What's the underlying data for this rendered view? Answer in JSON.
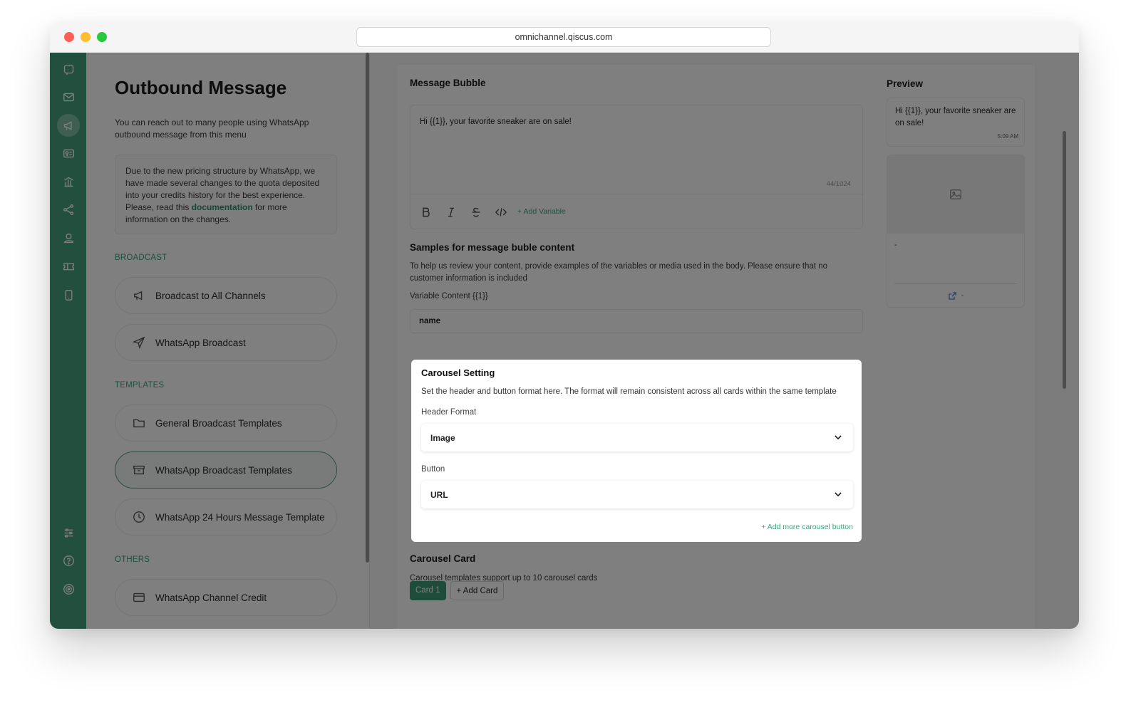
{
  "browser": {
    "url": "omnichannel.qiscus.com"
  },
  "rail": {
    "icons": [
      "chat-icon",
      "mail-icon",
      "megaphone-icon",
      "contact-card-icon",
      "analytics-icon",
      "integration-icon",
      "user-icon",
      "ticket-icon",
      "mobile-icon",
      "settings-sliders-icon",
      "help-icon",
      "target-icon"
    ]
  },
  "sidebar": {
    "title": "Outbound Message",
    "description": "You can reach out to many people using WhatsApp outbound message from this menu",
    "notice_before": "Due to the new pricing structure by WhatsApp, we have made several changes to the quota deposited into your credits history for the best experience. Please, read this ",
    "notice_link": "documentation",
    "notice_after": " for more information on the changes.",
    "sections": {
      "broadcast": "BROADCAST",
      "templates": "TEMPLATES",
      "others": "OTHERS"
    },
    "items": {
      "broadcast_all": "Broadcast to All Channels",
      "whatsapp_broadcast": "WhatsApp Broadcast",
      "general_templates": "General Broadcast Templates",
      "whatsapp_templates": "WhatsApp Broadcast Templates",
      "wa_24h_template": "WhatsApp 24 Hours Message Template",
      "channel_credit": "WhatsApp Channel Credit"
    }
  },
  "editor": {
    "bubble_title": "Message Bubble",
    "message": "Hi {{1}}, your favorite sneaker are on sale!",
    "counter": "44/1024",
    "add_variable": "+ Add Variable",
    "samples_title": "Samples for message buble content",
    "samples_desc": "To help us review your content, provide examples of the variables or media used in the body. Please ensure that no customer information is included",
    "variable_label": "Variable Content {{1}}",
    "variable_value": "name",
    "carousel_card_title": "Carousel Card",
    "carousel_card_desc": "Carousel templates support up to 10 carousel cards",
    "card_tab": "Card 1",
    "add_card": "+ Add Card"
  },
  "preview": {
    "title": "Preview",
    "message": "Hi {{1}}, your favorite sneaker are on sale!",
    "time": "5:09 AM",
    "card_body": "-",
    "card_button": "-"
  },
  "modal": {
    "title": "Carousel Setting",
    "description": "Set the header and button format here. The format will remain consistent across all cards within the same template",
    "header_label": "Header Format",
    "header_value": "Image",
    "button_label": "Button",
    "button_value": "URL",
    "add_button": "+ Add more carousel button"
  },
  "colors": {
    "brand": "#46a07d",
    "accent_text": "#3aa57a",
    "overlay": "rgba(0,0,0,0.5)"
  }
}
